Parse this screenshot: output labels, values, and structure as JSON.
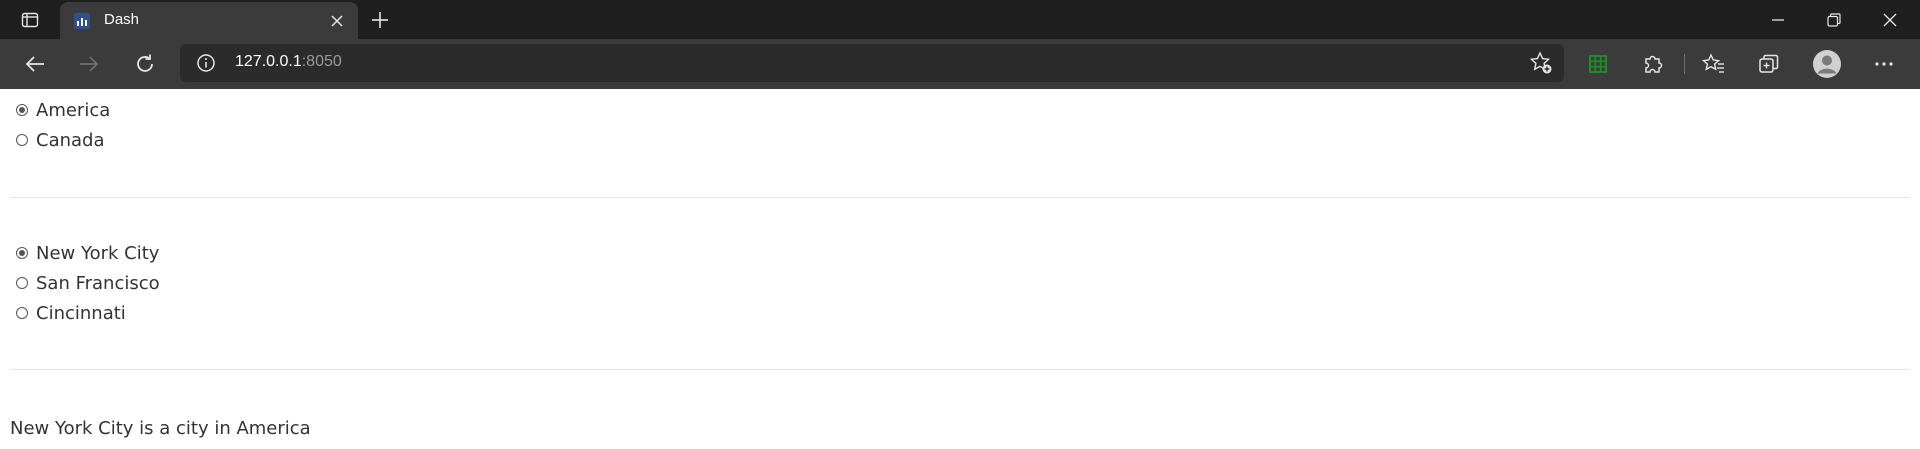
{
  "browser": {
    "tab": {
      "title": "Dash"
    },
    "address": {
      "host": "127.0.0.1",
      "port": ":8050"
    }
  },
  "page": {
    "country_radio": {
      "options": [
        "America",
        "Canada"
      ],
      "selected": "America"
    },
    "city_radio": {
      "options": [
        "New York City",
        "San Francisco",
        "Cincinnati"
      ],
      "selected": "New York City"
    },
    "output": "New York City is a city in America"
  }
}
